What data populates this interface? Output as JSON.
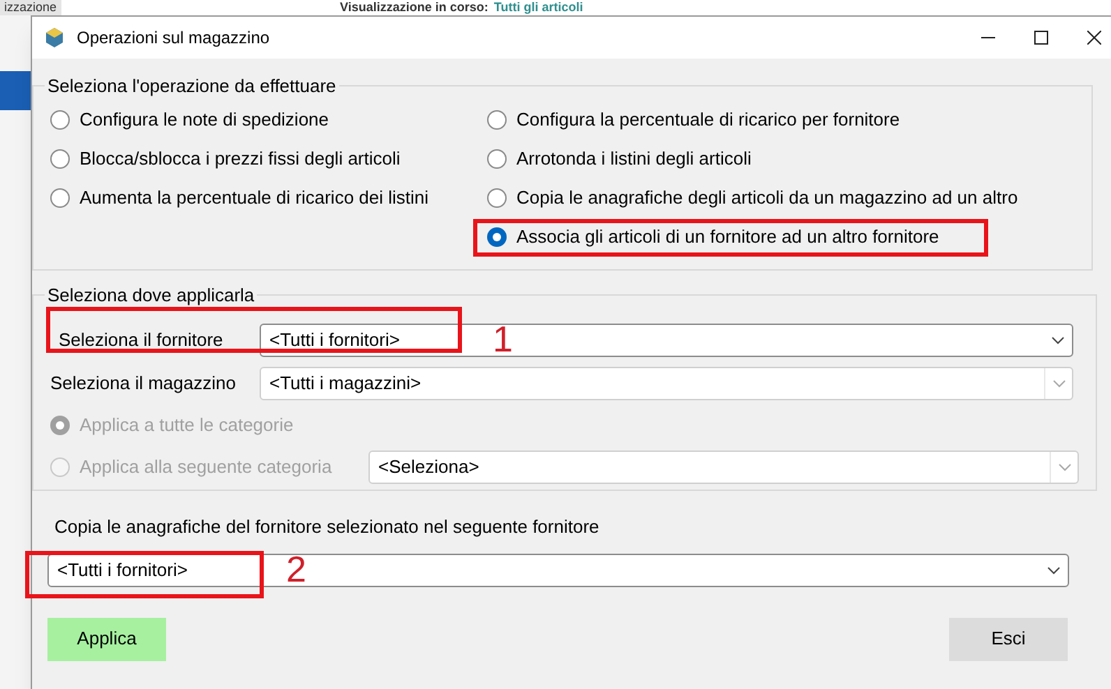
{
  "background": {
    "tab": "izzazione",
    "header_label": "Visualizzazione in corso:",
    "header_value": "Tutti gli articoli"
  },
  "window": {
    "title": "Operazioni sul magazzino"
  },
  "operation_group": {
    "title": "Seleziona l'operazione da effettuare",
    "columns": [
      [
        {
          "label": "Configura le note di spedizione",
          "selected": false
        },
        {
          "label": "Blocca/sblocca i prezzi fissi degli articoli",
          "selected": false
        },
        {
          "label": "Aumenta la percentuale di ricarico dei listini",
          "selected": false
        }
      ],
      [
        {
          "label": "Configura la percentuale di ricarico per fornitore",
          "selected": false
        },
        {
          "label": "Arrotonda i listini degli articoli",
          "selected": false
        },
        {
          "label": "Copia le anagrafiche degli articoli da un magazzino ad un altro",
          "selected": false
        },
        {
          "label": "Associa gli articoli di un fornitore ad un altro fornitore",
          "selected": true,
          "highlighted": true
        }
      ]
    ]
  },
  "target_group": {
    "title": "Seleziona dove applicarla",
    "supplier": {
      "label": "Seleziona il fornitore",
      "value": "<Tutti i fornitori>"
    },
    "warehouse": {
      "label": "Seleziona il magazzino",
      "value": "<Tutti i magazzini>"
    },
    "categories": [
      {
        "label": "Applica a tutte le categorie",
        "selected": true,
        "disabled": true
      },
      {
        "label": "Applica alla seguente categoria",
        "selected": false,
        "disabled": true,
        "value": "<Seleziona>"
      }
    ]
  },
  "copy": {
    "label": "Copia le anagrafiche del fornitore selezionato nel seguente fornitore",
    "value": "<Tutti i fornitori>"
  },
  "annotations": [
    {
      "number": "1"
    },
    {
      "number": "2"
    }
  ],
  "buttons": [
    {
      "label": "Applica",
      "kind": "primary"
    },
    {
      "label": "Esci",
      "kind": "secondary"
    }
  ]
}
